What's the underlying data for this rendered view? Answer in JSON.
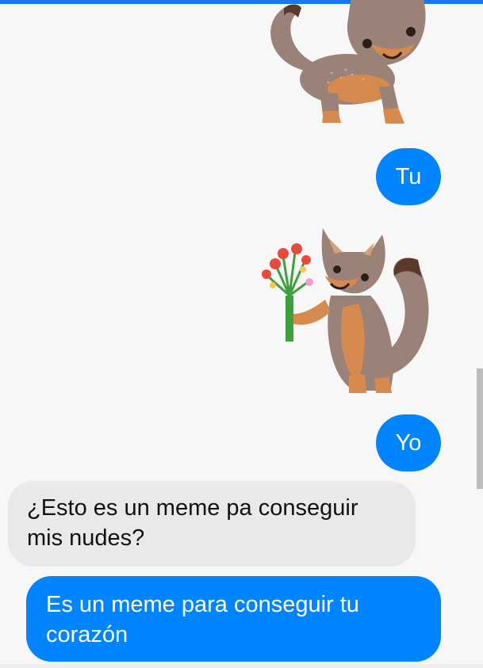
{
  "colors": {
    "top_bar": "#1877f2",
    "outgoing_bubble": "#0084ff",
    "incoming_bubble": "#e9e9e9",
    "background": "#f7f7f7"
  },
  "conversation": {
    "messages": [
      {
        "type": "sticker",
        "direction": "outgoing",
        "icon": "fox-sticker-icon"
      },
      {
        "type": "text",
        "direction": "outgoing",
        "text": "Tu"
      },
      {
        "type": "sticker",
        "direction": "outgoing",
        "icon": "fox-with-flowers-sticker-icon"
      },
      {
        "type": "text",
        "direction": "outgoing",
        "text": "Yo"
      },
      {
        "type": "text",
        "direction": "incoming",
        "text": "¿Esto es un meme pa conseguir mis nudes?"
      },
      {
        "type": "text",
        "direction": "outgoing",
        "text": "Es un meme para conseguir tu corazón"
      }
    ]
  }
}
